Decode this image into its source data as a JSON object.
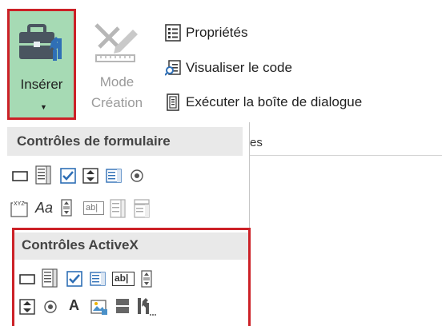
{
  "ribbon": {
    "insert_button_label": "Insérer",
    "mode_creation_line1": "Mode",
    "mode_creation_line2": "Création",
    "commands": [
      {
        "label": "Propriétés",
        "icon": "properties-icon"
      },
      {
        "label": "Visualiser le code",
        "icon": "view-code-icon"
      },
      {
        "label": "Exécuter la boîte de dialogue",
        "icon": "run-dialog-icon"
      }
    ],
    "group_label_tail": "es"
  },
  "dropdown": {
    "form_controls_header": "Contrôles de formulaire",
    "form_controls": [
      [
        "button-icon",
        "combo-box-icon",
        "checkbox-icon",
        "spin-button-icon",
        "list-box-icon",
        "option-button-icon"
      ],
      [
        "group-box-icon",
        "label-icon",
        "scroll-bar-icon",
        "text-field-icon",
        "combo-list-icon",
        "combo-dropdown-icon"
      ]
    ],
    "form_label_icon_text": "Aa",
    "form_groupbox_icon_text": "XYZ",
    "form_textfield_icon_text": "ab|",
    "activex_header": "Contrôles ActiveX",
    "activex_controls": [
      [
        "command-button-icon",
        "combo-box-icon",
        "checkbox-icon",
        "list-box-icon",
        "text-box-icon",
        "scroll-bar-icon"
      ],
      [
        "spin-button-icon",
        "option-button-icon",
        "label-icon",
        "image-icon",
        "toggle-button-icon",
        "more-controls-icon"
      ]
    ],
    "activex_textbox_icon_text": "ab|",
    "activex_label_icon_text": "A"
  },
  "colors": {
    "highlight_border": "#cc2127",
    "insert_bg": "#a6dab4",
    "header_bg": "#e9e9e9"
  }
}
